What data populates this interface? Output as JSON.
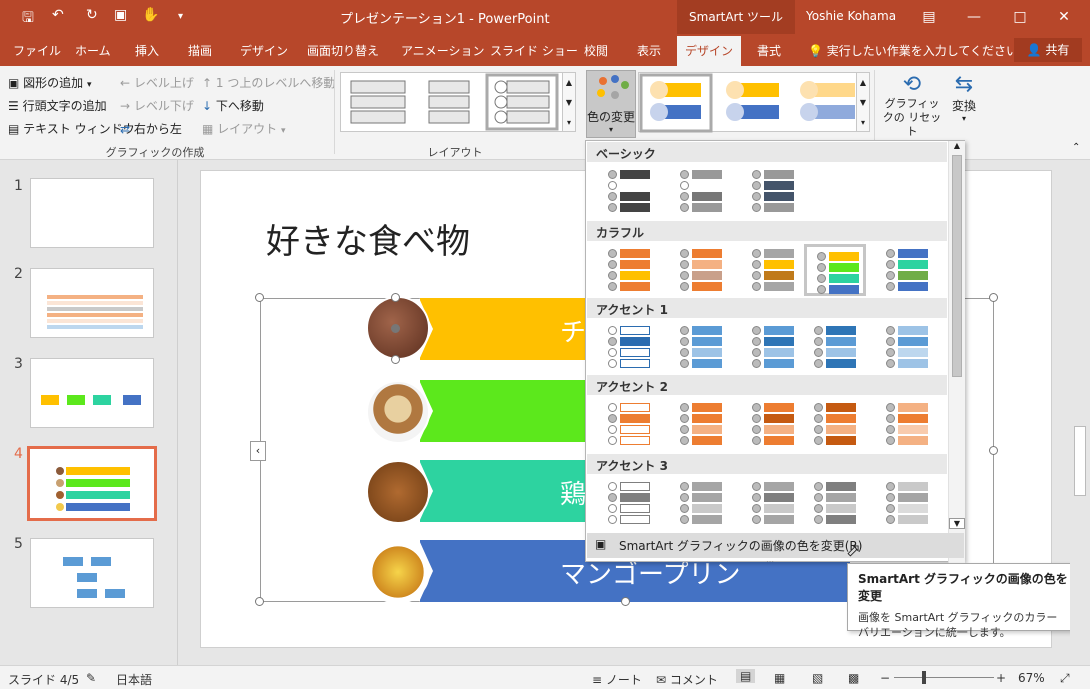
{
  "app": {
    "doc_title": "プレゼンテーション1 - PowerPoint",
    "context_tab": "SmartArt ツール",
    "user": "Yoshie Kohama",
    "accent": "#b7472a"
  },
  "tabs": [
    "ファイル",
    "ホーム",
    "挿入",
    "描画",
    "デザイン",
    "画面切り替え",
    "アニメーション",
    "スライド ショー",
    "校閲",
    "表示",
    "デザイン",
    "書式"
  ],
  "tell_me": "実行したい作業を入力してください",
  "share": "共有",
  "ribbon": {
    "create": {
      "add_shape": "図形の追加",
      "add_bullet": "行頭文字の追加",
      "text_pane": "テキスト ウィンドウ",
      "promote": "レベル上げ",
      "demote": "レベル下げ",
      "rtl": "右から左",
      "move_up": "1 つ上のレベルへ移動",
      "move_down": "下へ移動",
      "layout": "レイアウト",
      "label": "グラフィックの作成"
    },
    "layouts_label": "レイアウト",
    "change_colors": "色の変更",
    "reset_graphic": "グラフィックの リセット",
    "convert": "変換"
  },
  "thumbnails": [
    "1",
    "2",
    "3",
    "4",
    "5"
  ],
  "slide": {
    "title": "好きな食べ物",
    "items": [
      {
        "text": "チ",
        "color": "#ffc000"
      },
      {
        "text": "",
        "color": "#5ce81c"
      },
      {
        "text": "鶏",
        "color": "#2dd3a0"
      },
      {
        "text": "マンゴープリン",
        "color": "#4472c4"
      }
    ]
  },
  "color_menu": {
    "sections": [
      "ベーシック",
      "カラフル",
      "アクセント 1",
      "アクセント 2",
      "アクセント 3"
    ],
    "recolor_item": "SmartArt グラフィックの画像の色を変更(R)"
  },
  "tooltip": {
    "title": "SmartArt グラフィックの画像の色を変更",
    "body": "画像を SmartArt グラフィックのカラー バリエーションに統一します。"
  },
  "status": {
    "slide_info": "スライド 4/5",
    "language": "日本語",
    "notes": "ノート",
    "comments": "コメント",
    "zoom": "67%"
  }
}
